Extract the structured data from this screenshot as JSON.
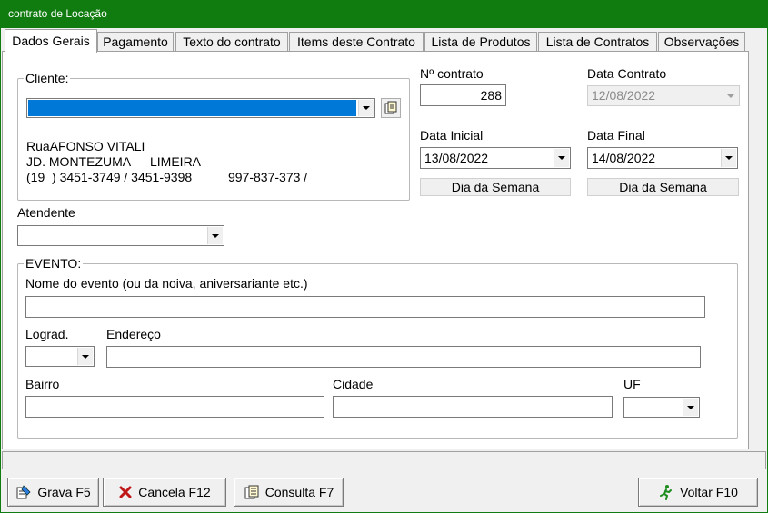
{
  "window": {
    "title": "contrato de Locação"
  },
  "tabs": [
    {
      "label": "Dados Gerais",
      "active": true
    },
    {
      "label": "Pagamento"
    },
    {
      "label": "Texto do contrato"
    },
    {
      "label": "Items deste Contrato"
    },
    {
      "label": "Lista de Produtos"
    },
    {
      "label": "Lista de Contratos"
    },
    {
      "label": "Observações"
    }
  ],
  "cliente": {
    "title": "Cliente:",
    "selected": "",
    "lookup_icon": "lookup-icon",
    "address_line1_prefix": "Rua",
    "address_line1": "AFONSO VITALI",
    "neighborhood": "JD. MONTEZUMA",
    "city": "LIMEIRA",
    "phones": "(19  ) 3451-3749 / 3451-9398",
    "mobile": "997-837-373 /"
  },
  "contrato": {
    "numero_label": "Nº contrato",
    "numero_value": "288",
    "data_contrato_label": "Data Contrato",
    "data_contrato_value": "12/08/2022",
    "data_inicial_label": "Data Inicial",
    "data_inicial_value": "13/08/2022",
    "data_final_label": "Data Final",
    "data_final_value": "14/08/2022",
    "dia_semana_inicial": "Dia da Semana",
    "dia_semana_final": "Dia da Semana"
  },
  "atendente": {
    "label": "Atendente",
    "value": ""
  },
  "evento": {
    "title": "EVENTO:",
    "nome_label": "Nome do evento (ou da noiva, aniversariante etc.)",
    "nome_value": "",
    "lograd_label": "Lograd.",
    "lograd_value": "",
    "endereco_label": "Endereço",
    "endereco_value": "",
    "bairro_label": "Bairro",
    "bairro_value": "",
    "cidade_label": "Cidade",
    "cidade_value": "",
    "uf_label": "UF",
    "uf_value": ""
  },
  "buttons": {
    "grava": "Grava F5",
    "cancela": "Cancela F12",
    "consulta": "Consulta F7",
    "voltar": "Voltar F10"
  },
  "colors": {
    "titlebar": "#107c10",
    "selection": "#0078d7",
    "cancel_icon": "#c01818",
    "exit_icon": "#1e8c1e"
  }
}
